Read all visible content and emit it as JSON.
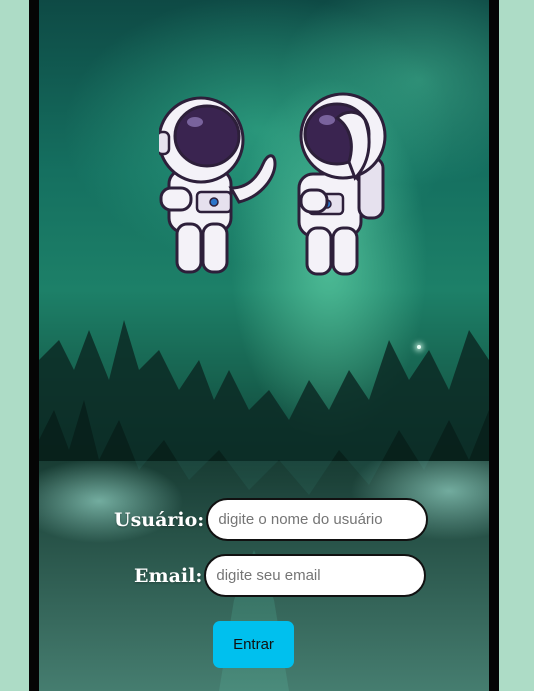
{
  "form": {
    "user_label": "Usuário:",
    "user_placeholder": "digite o nome do usuário",
    "email_label": "Email:",
    "email_placeholder": "digite seu email",
    "submit_label": "Entrar"
  },
  "colors": {
    "page_background": "#addcc6",
    "button": "#00c0ee",
    "aurora": "#1d8068"
  }
}
